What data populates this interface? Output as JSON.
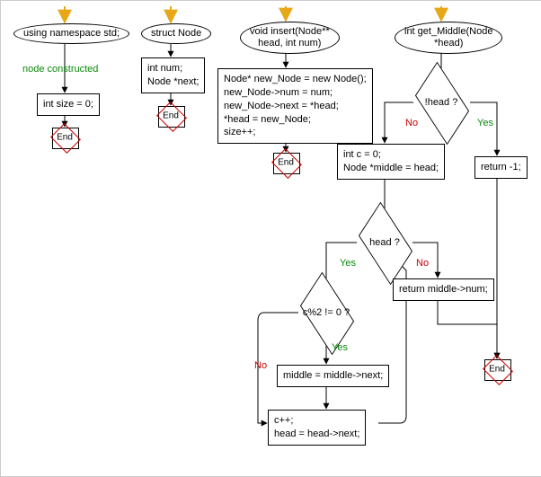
{
  "chart_data": {
    "type": "flowchart",
    "title": "",
    "functions": [
      {
        "name": "using namespace std;",
        "nodes": [
          {
            "id": "n1",
            "type": "start",
            "text": "using namespace std;"
          },
          {
            "id": "n1a",
            "type": "annotation",
            "text": "node constructed"
          },
          {
            "id": "n2",
            "type": "process",
            "text": "int size = 0;"
          },
          {
            "id": "n3",
            "type": "end",
            "text": "End"
          }
        ],
        "edges": [
          {
            "from": "entry",
            "to": "n1"
          },
          {
            "from": "n1",
            "to": "n2"
          },
          {
            "from": "n2",
            "to": "n3"
          }
        ]
      },
      {
        "name": "struct Node",
        "nodes": [
          {
            "id": "s1",
            "type": "start",
            "text": "struct Node"
          },
          {
            "id": "s2",
            "type": "process",
            "text": "int num;\nNode *next;"
          },
          {
            "id": "s3",
            "type": "end",
            "text": "End"
          }
        ],
        "edges": [
          {
            "from": "entry",
            "to": "s1"
          },
          {
            "from": "s1",
            "to": "s2"
          },
          {
            "from": "s2",
            "to": "s3"
          }
        ]
      },
      {
        "name": "void insert(Node** head, int num)",
        "nodes": [
          {
            "id": "i1",
            "type": "start",
            "text": "void insert(Node**\nhead, int num)"
          },
          {
            "id": "i2",
            "type": "process",
            "text": "Node* new_Node = new Node();\nnew_Node->num = num;\nnew_Node->next = *head;\n*head = new_Node;\nsize++;"
          },
          {
            "id": "i3",
            "type": "end",
            "text": "End"
          }
        ],
        "edges": [
          {
            "from": "entry",
            "to": "i1"
          },
          {
            "from": "i1",
            "to": "i2"
          },
          {
            "from": "i2",
            "to": "i3"
          }
        ]
      },
      {
        "name": "int get_Middle(Node *head)",
        "nodes": [
          {
            "id": "g1",
            "type": "start",
            "text": "int get_Middle(Node\n*head)"
          },
          {
            "id": "g2",
            "type": "decision",
            "text": "!head ?"
          },
          {
            "id": "g3",
            "type": "process",
            "text": "return -1;"
          },
          {
            "id": "g4",
            "type": "process",
            "text": "int c = 0;\nNode *middle = head;"
          },
          {
            "id": "g5",
            "type": "decision",
            "text": "head ?"
          },
          {
            "id": "g6",
            "type": "process",
            "text": "return middle->num;"
          },
          {
            "id": "g7",
            "type": "decision",
            "text": "c%2 != 0 ?"
          },
          {
            "id": "g8",
            "type": "process",
            "text": "middle = middle->next;"
          },
          {
            "id": "g9",
            "type": "process",
            "text": "c++;\nhead = head->next;"
          },
          {
            "id": "g10",
            "type": "end",
            "text": "End"
          }
        ],
        "edges": [
          {
            "from": "entry",
            "to": "g1"
          },
          {
            "from": "g1",
            "to": "g2"
          },
          {
            "from": "g2",
            "to": "g3",
            "label": "Yes"
          },
          {
            "from": "g2",
            "to": "g4",
            "label": "No"
          },
          {
            "from": "g4",
            "to": "g5"
          },
          {
            "from": "g5",
            "to": "g6",
            "label": "No"
          },
          {
            "from": "g5",
            "to": "g7",
            "label": "Yes"
          },
          {
            "from": "g7",
            "to": "g8",
            "label": "Yes"
          },
          {
            "from": "g7",
            "to": "g9",
            "label": "No"
          },
          {
            "from": "g8",
            "to": "g9"
          },
          {
            "from": "g9",
            "to": "g5"
          },
          {
            "from": "g6",
            "to": "g10"
          },
          {
            "from": "g3",
            "to": "g10"
          }
        ]
      }
    ],
    "edge_labels": {
      "yes": "Yes",
      "no": "No"
    }
  },
  "end_label": "End"
}
